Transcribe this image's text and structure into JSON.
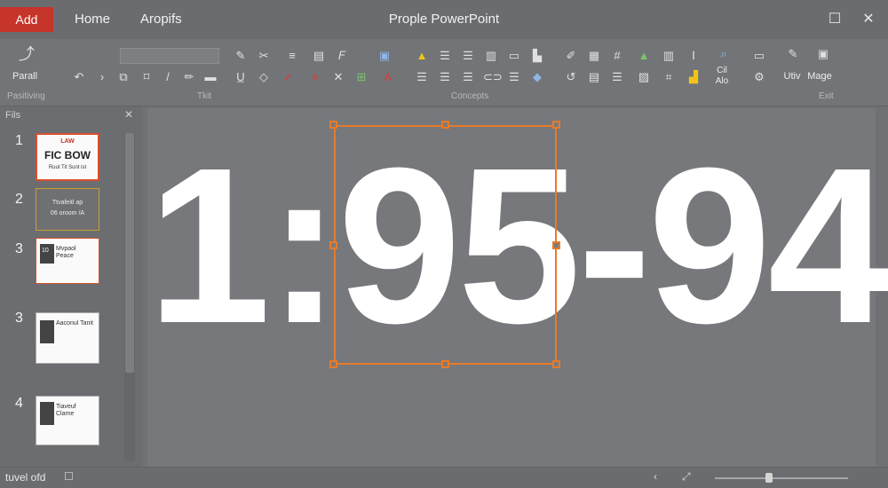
{
  "titlebar": {
    "tabs": [
      "Add",
      "Home",
      "Aropifs"
    ],
    "app_title": "Prople PowerPoint",
    "restore_glyph": "☐",
    "close_glyph": "✕"
  },
  "ribbon": {
    "paint_label": "Parall",
    "groups": [
      "Pasitiving",
      "Tkit",
      "Concepts",
      "Exit"
    ],
    "style_button_label": "Cil\nAlo",
    "right_buttons": [
      "Utiv",
      "Mage"
    ]
  },
  "panel": {
    "header": "Fils",
    "slides": [
      {
        "number": "1",
        "line1": "LAW",
        "line2": "FIC BOW",
        "line3": "Ruut Tit Sunt ist"
      },
      {
        "number": "2",
        "line1": "Ttvafeitl ap",
        "line2": "06 oroom /A"
      },
      {
        "number": "3",
        "line1": "10",
        "line2": "Mvpaol Peace"
      },
      {
        "number": "3",
        "line1": "Aaconul Tanit"
      },
      {
        "number": "4",
        "line1": "Tiaveuf Clame"
      }
    ]
  },
  "slide": {
    "big_text": "1:95-94"
  },
  "statusbar": {
    "text": "tuvel ofd"
  },
  "colors": {
    "accent": "#c7342a",
    "selection": "#e77b2b"
  }
}
